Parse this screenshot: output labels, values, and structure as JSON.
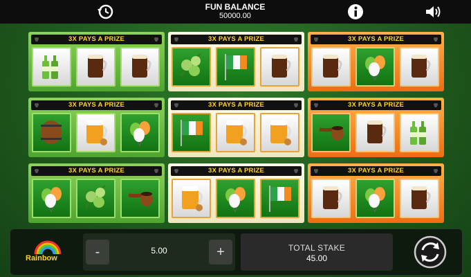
{
  "header": {
    "balance_label": "FUN BALANCE",
    "balance_value": "50000.00",
    "history_icon": "history-icon",
    "info_icon": "info-icon",
    "sound_icon": "sound-icon"
  },
  "cards": [
    {
      "theme": "green",
      "banner": "3X PAYS A PRIZE",
      "symbols": [
        "bottles",
        "beer",
        "beer"
      ]
    },
    {
      "theme": "cream",
      "banner": "3X PAYS A PRIZE",
      "symbols": [
        "hops",
        "flag",
        "beer"
      ]
    },
    {
      "theme": "orange",
      "banner": "3X PAYS A PRIZE",
      "symbols": [
        "beer",
        "balloons",
        "beer"
      ]
    },
    {
      "theme": "green",
      "banner": "3X PAYS A PRIZE",
      "symbols": [
        "barrel",
        "lager",
        "balloons"
      ]
    },
    {
      "theme": "cream",
      "banner": "3X PAYS A PRIZE",
      "symbols": [
        "flag",
        "lager",
        "lager"
      ]
    },
    {
      "theme": "orange",
      "banner": "3X PAYS A PRIZE",
      "symbols": [
        "pipe",
        "beer",
        "bottles"
      ]
    },
    {
      "theme": "green",
      "banner": "3X PAYS A PRIZE",
      "symbols": [
        "balloons",
        "hops",
        "pipe"
      ]
    },
    {
      "theme": "cream",
      "banner": "3X PAYS A PRIZE",
      "symbols": [
        "lager",
        "balloons",
        "flag"
      ]
    },
    {
      "theme": "orange",
      "banner": "3X PAYS A PRIZE",
      "symbols": [
        "beer",
        "balloons",
        "beer"
      ]
    }
  ],
  "footer": {
    "logo_text": "Rainbow",
    "minus": "-",
    "stake": "5.00",
    "plus": "+",
    "total_label": "TOTAL STAKE",
    "total_value": "45.00",
    "spin_icon": "refresh-icon"
  },
  "colors": {
    "green": "#4ea530",
    "cream": "#efe6bf",
    "orange": "#ef6d12",
    "banner_text": "#ffd22b"
  }
}
